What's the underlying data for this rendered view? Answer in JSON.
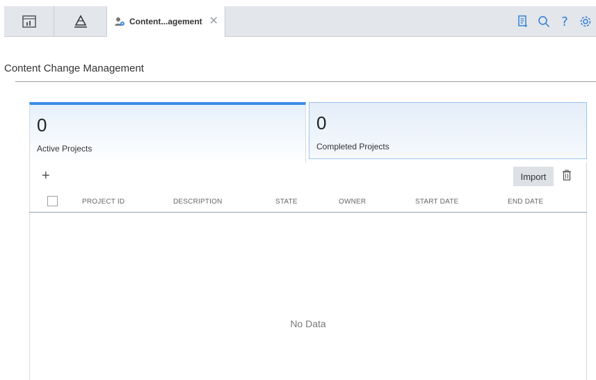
{
  "tabs": {
    "active_label": "Content...agement"
  },
  "page": {
    "title": "Content Change Management"
  },
  "summary": {
    "active": {
      "count": "0",
      "label": "Active Projects"
    },
    "completed": {
      "count": "0",
      "label": "Completed Projects"
    }
  },
  "grid": {
    "add_label": "+",
    "import_label": "Import",
    "columns": [
      "PROJECT ID",
      "DESCRIPTION",
      "STATE",
      "OWNER",
      "START DATE",
      "END DATE"
    ],
    "empty_text": "No Data"
  },
  "colors": {
    "accent": "#3a8ee6",
    "action_icon": "#2b7bd6"
  }
}
